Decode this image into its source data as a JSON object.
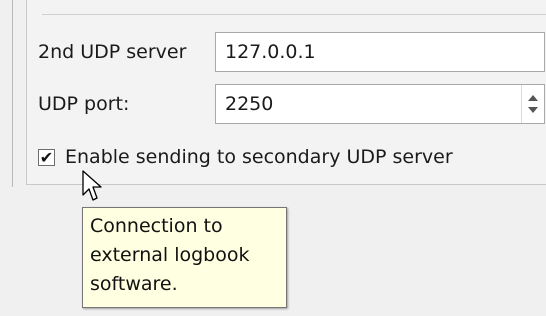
{
  "settings": {
    "udp_server_label": "2nd UDP server",
    "udp_server_value": "127.0.0.1",
    "udp_port_label": "UDP port:",
    "udp_port_value": "2250",
    "enable_checkbox_label": "Enable sending to secondary UDP server",
    "enable_checkbox_checked": true,
    "checkmark": "✔"
  },
  "tooltip": {
    "lines": [
      "Connection to",
      "external logbook",
      "software."
    ]
  },
  "icons": {
    "spin_up": "spin-up-arrow-icon",
    "spin_down": "spin-down-arrow-icon",
    "cursor": "arrow-cursor-icon"
  }
}
